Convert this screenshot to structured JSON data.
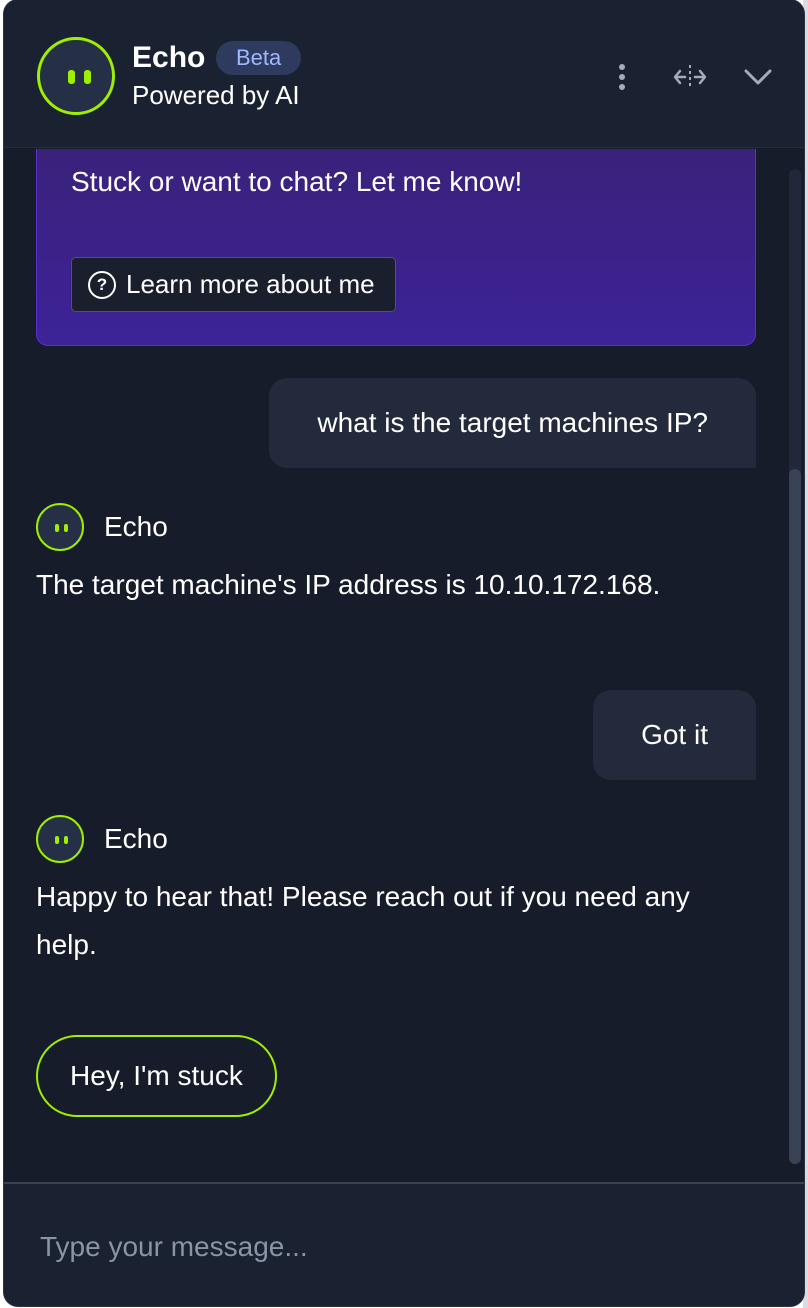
{
  "header": {
    "title": "Echo",
    "badge": "Beta",
    "subtitle": "Powered by AI",
    "actions": [
      "more-vertical-icon",
      "expand-horizontal-icon",
      "chevron-down-icon"
    ]
  },
  "intro": {
    "text": "Stuck or want to chat? Let me know!",
    "learn_more_label": "Learn more about me",
    "learn_more_icon": "question-circle-icon"
  },
  "messages": [
    {
      "role": "user",
      "text": "what is the target machines IP?"
    },
    {
      "role": "bot",
      "name": "Echo",
      "text": "The target machine's IP address is 10.10.172.168."
    },
    {
      "role": "user",
      "text": "Got it"
    },
    {
      "role": "bot",
      "name": "Echo",
      "text": "Happy to hear that! Please reach out if you need any help."
    }
  ],
  "suggestion": {
    "label": "Hey, I'm stuck"
  },
  "composer": {
    "placeholder": "Type your message..."
  },
  "colors": {
    "accent": "#9fef00",
    "panel": "#161c2a",
    "header": "#1a2131",
    "intro_card": "#3c2398",
    "user_bubble": "#232a3b",
    "badge_bg": "#2e3a5e",
    "badge_text": "#9fb8ff"
  }
}
